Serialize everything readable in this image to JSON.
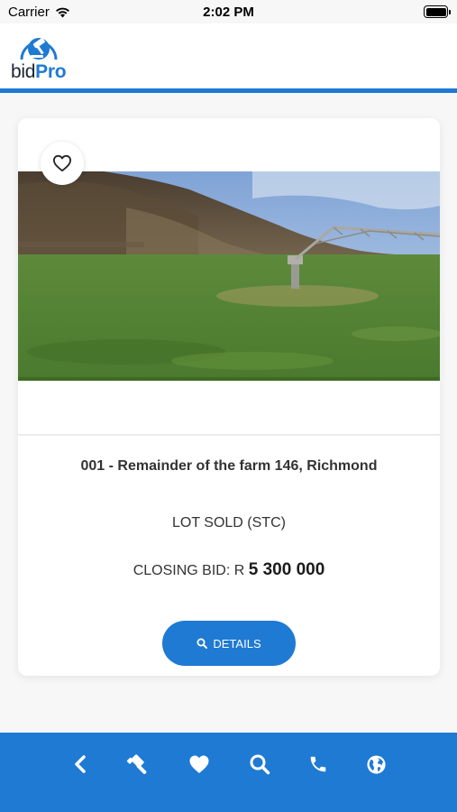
{
  "status_bar": {
    "carrier": "Carrier",
    "time": "2:02 PM"
  },
  "header": {
    "logo_text_1": "bid",
    "logo_text_2": "Pro",
    "logo_icon": "auction-gavel-logo-icon"
  },
  "lot": {
    "title": "001 - Remainder of the farm 146, Richmond",
    "status": "LOT SOLD (STC)",
    "closing_label": "CLOSING BID: R",
    "closing_amount": "5 300 000",
    "details_label": "DETAILS",
    "favorite_icon": "heart-outline-icon",
    "details_icon": "search-icon"
  },
  "bottom_nav": [
    {
      "icon": "chevron-left-icon"
    },
    {
      "icon": "gavel-icon"
    },
    {
      "icon": "heart-icon"
    },
    {
      "icon": "search-icon"
    },
    {
      "icon": "phone-icon"
    },
    {
      "icon": "globe-icon"
    }
  ],
  "colors": {
    "brand_blue": "#1f7ad3",
    "text_dark": "#333333",
    "card_bg": "#ffffff"
  }
}
